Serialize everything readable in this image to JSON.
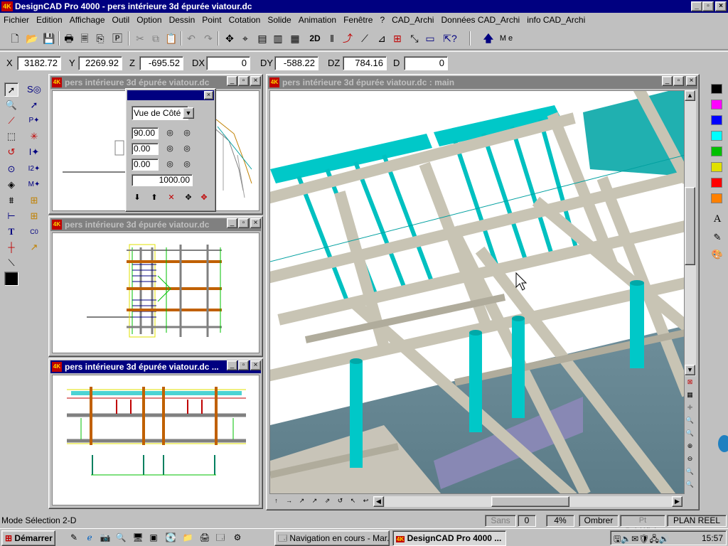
{
  "app": {
    "icon_label": "4K",
    "title": "DesignCAD Pro 4000 - pers intérieure 3d épurée viatour.dc"
  },
  "window_controls": {
    "minimize": "_",
    "maximize": "▫",
    "close": "×"
  },
  "menu": [
    "Fichier",
    "Edition",
    "Affichage",
    "Outil",
    "Option",
    "Dessin",
    "Point",
    "Cotation",
    "Solide",
    "Animation",
    "Fenêtre",
    "?",
    "CAD_Archi",
    "Données CAD_Archi",
    "info CAD_Archi"
  ],
  "toolbar": {
    "icons": [
      "new-file-icon",
      "open-folder-icon",
      "save-icon",
      "print-icon",
      "print-preview-icon",
      "copy-page-icon",
      "paste-special-icon",
      "cut-icon",
      "copy-icon",
      "paste-icon",
      "undo-icon",
      "redo-icon",
      "move-icon",
      "snap-icon",
      "view-front-icon",
      "view-side-icon",
      "view-top-icon",
      "2d-mode-icon",
      "pause-icon",
      "axis-icon",
      "point-icon",
      "line-point-icon",
      "select-nodes-icon",
      "scale-icon",
      "window-icon",
      "help-pointer-icon",
      "arrow-up-icon"
    ],
    "mode_2d": "2D",
    "extra_label": "M e"
  },
  "coords": {
    "x_label": "X",
    "x": "3182.72",
    "y_label": "Y",
    "y": "2269.92",
    "z_label": "Z",
    "z": "-695.52",
    "dx_label": "DX",
    "dx": "0",
    "dy_label": "DY",
    "dy": "-588.22",
    "dz_label": "DZ",
    "dz": "784.16",
    "d_label": "D",
    "d": "0"
  },
  "windows": {
    "top_left_title": "pers intérieure 3d épurée viatour.dc",
    "mid_left_title": "pers intérieure 3d épurée viatour.dc",
    "bottom_left_title": "pers intérieure 3d épurée viatour.dc ...",
    "main_title": "pers intérieure 3d épurée viatour.dc : main"
  },
  "view_dialog": {
    "view_select": "Vue de Côté",
    "angle1": "90.00",
    "angle2": "0.00",
    "angle3": "0.00",
    "distance": "1000.00"
  },
  "palette_colors": [
    "#000000",
    "#ff00ff",
    "#0000ff",
    "#00ffff",
    "#00c000",
    "#e0e000",
    "#ff0000",
    "#ff8000"
  ],
  "palette_text_tool": "A",
  "status": {
    "mode": "Mode Sélection 2-D",
    "sans": "Sans",
    "zero": "0",
    "percent": "4%",
    "ombrer": "Ombrer",
    "pt_predefinis": "Pt Prédéfinis",
    "plan_reel": "PLAN REEL"
  },
  "taskbar": {
    "start": "Démarrer",
    "task1": "Navigation en cours - Mar...",
    "task2": "DesignCAD Pro 4000 ...",
    "clock": "15:57"
  }
}
